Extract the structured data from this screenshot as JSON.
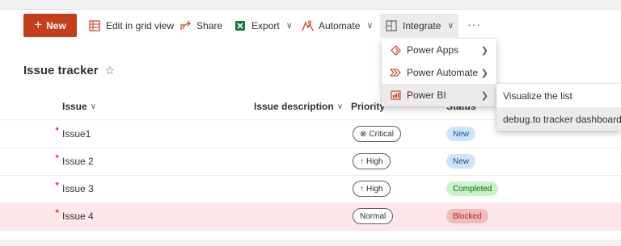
{
  "commandbar": {
    "new_label": "New",
    "edit_grid_label": "Edit in grid view",
    "share_label": "Share",
    "export_label": "Export",
    "automate_label": "Automate",
    "integrate_label": "Integrate",
    "more_label": "···"
  },
  "list_title": "Issue tracker",
  "columns": {
    "issue": "Issue",
    "description": "Issue description",
    "priority": "Priority",
    "status": "Status"
  },
  "rows": [
    {
      "issue": "Issue1",
      "priority": "Critical",
      "status": "New"
    },
    {
      "issue": "Issue 2",
      "priority": "High",
      "status": "New"
    },
    {
      "issue": "Issue 3",
      "priority": "High",
      "status": "Completed"
    },
    {
      "issue": "Issue 4",
      "priority": "Normal",
      "status": "Blocked"
    }
  ],
  "integrate_menu": {
    "items": [
      {
        "label": "Power Apps",
        "icon": "power-apps-icon"
      },
      {
        "label": "Power Automate",
        "icon": "power-automate-icon"
      },
      {
        "label": "Power BI",
        "icon": "power-bi-icon"
      }
    ]
  },
  "powerbi_submenu": {
    "items": [
      {
        "label": "Visualize the list"
      },
      {
        "label": "debug.to tracker dashboard"
      }
    ]
  },
  "colors": {
    "accent": "#c43e1c",
    "selected_row": "#fde7e9",
    "status_new": "#cfe4fa",
    "status_completed": "#caf0cc",
    "status_blocked": "#f1bbbc"
  }
}
